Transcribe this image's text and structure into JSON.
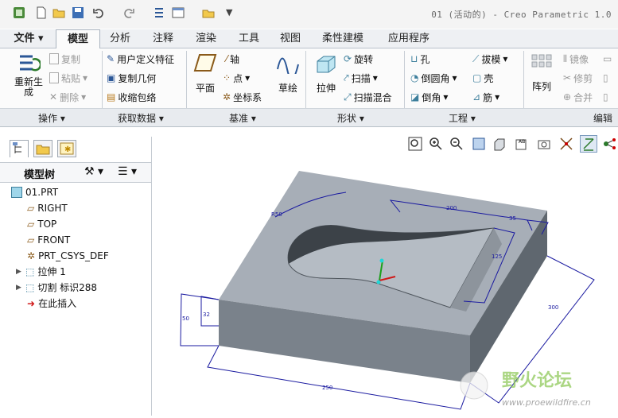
{
  "window": {
    "title": "01 (活动的) - Creo Parametric 1.0"
  },
  "tabs": [
    {
      "label": "文件",
      "active": false,
      "dropdown": true
    },
    {
      "label": "模型",
      "active": true
    },
    {
      "label": "分析",
      "active": false
    },
    {
      "label": "注释",
      "active": false
    },
    {
      "label": "渲染",
      "active": false
    },
    {
      "label": "工具",
      "active": false
    },
    {
      "label": "视图",
      "active": false
    },
    {
      "label": "柔性建模",
      "active": false
    },
    {
      "label": "应用程序",
      "active": false
    }
  ],
  "ribbon": {
    "operations": {
      "regen": "重新生",
      "regen2": "成",
      "copy": "复制",
      "paste": "粘贴",
      "delete": "删除"
    },
    "getdata": {
      "udf": "用户定义特征",
      "copygeom": "复制几何",
      "shrinkwrap": "收缩包络"
    },
    "datum": {
      "plane": "平面",
      "axis": "轴",
      "point": "点",
      "csys": "坐标系",
      "sketch": "草绘"
    },
    "shapes": {
      "extrude": "拉伸",
      "revolve": "旋转",
      "sweep": "扫描",
      "swept_blend": "扫描混合"
    },
    "engineering": {
      "hole": "孔",
      "round": "倒圆角",
      "chamfer": "倒角",
      "draft": "拔模",
      "shell": "壳",
      "rib": "筋"
    },
    "editing": {
      "pattern": "阵列",
      "mirror": "镜像",
      "trim": "修剪",
      "merge": "合并"
    },
    "groups": [
      "操作",
      "获取数据",
      "基准",
      "形状",
      "工程",
      "编辑"
    ]
  },
  "model_tree": {
    "header": "模型树",
    "items": [
      {
        "label": "01.PRT",
        "icon": "part-icon"
      },
      {
        "label": "RIGHT",
        "icon": "datum-plane-icon"
      },
      {
        "label": "TOP",
        "icon": "datum-plane-icon"
      },
      {
        "label": "FRONT",
        "icon": "datum-plane-icon"
      },
      {
        "label": "PRT_CSYS_DEF",
        "icon": "csys-icon"
      },
      {
        "label": "拉伸 1",
        "icon": "extrude-icon",
        "expandable": true
      },
      {
        "label": "切割 标识288",
        "icon": "cut-icon",
        "expandable": true
      },
      {
        "label": "在此插入",
        "icon": "insert-here-icon"
      }
    ]
  },
  "dimensions": {
    "r": "R50",
    "d200": "200",
    "d35": "35",
    "d125": "125",
    "d300": "300",
    "d50": "50",
    "d32": "32",
    "d250": "250"
  },
  "watermark": {
    "text": "野火论坛",
    "url": "www.proewildfire.cn"
  },
  "colors": {
    "accent": "#2b5797",
    "model_face_top": "#a6adb6",
    "model_side": "#717982",
    "dimension": "#1a1aa0"
  }
}
